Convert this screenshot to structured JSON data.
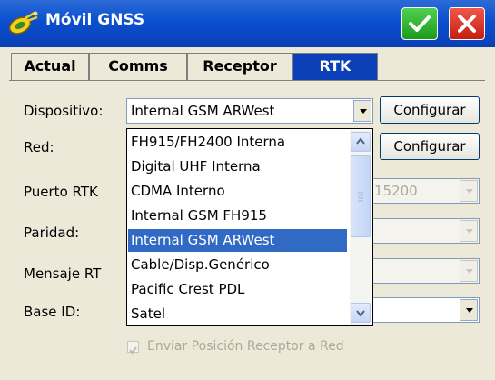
{
  "window": {
    "title": "Móvil GNSS",
    "icon": "satellite-icon",
    "ok_icon": "checkmark-icon",
    "close_icon": "close-icon"
  },
  "tabs": [
    {
      "label": "Actual",
      "active": false
    },
    {
      "label": "Comms",
      "active": false
    },
    {
      "label": "Receptor",
      "active": false
    },
    {
      "label": "RTK",
      "active": true
    }
  ],
  "form": {
    "dispositivo_label": "Dispositivo:",
    "dispositivo_value": "Internal GSM ARWest",
    "configurar_1": "Configurar",
    "red_label": "Red:",
    "configurar_2": "Configurar",
    "puerto_label": "Puerto RTK",
    "puerto_value_visible": "15200",
    "paridad_label": "Paridad:",
    "mensaje_label": "Mensaje RT",
    "base_label": "Base ID:",
    "enviar_label": "Enviar Posición Receptor a Red",
    "enviar_checked": true
  },
  "dropdown": {
    "items": [
      "FH915/FH2400 Interna",
      "Digital UHF Interna",
      "CDMA Interno",
      "Internal GSM FH915",
      "Internal GSM ARWest",
      "Cable/Disp.Genérico",
      "Pacific Crest PDL",
      "Satel"
    ],
    "selected_index": 4
  },
  "colors": {
    "titlebar": "#0b4fcf",
    "tab_active": "#0b40b8",
    "selection": "#316ac5",
    "background": "#ece9d8"
  }
}
